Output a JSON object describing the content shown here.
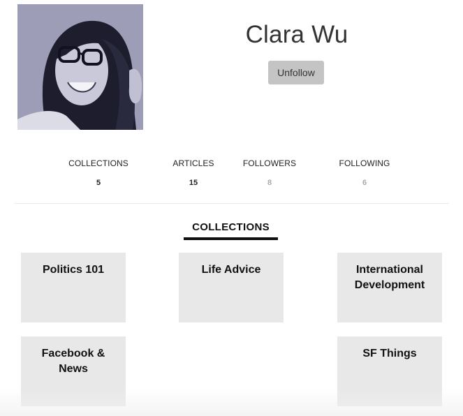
{
  "profile": {
    "name": "Clara Wu",
    "unfollow_label": "Unfollow",
    "avatar_icon": "profile-photo"
  },
  "stats": [
    {
      "label": "COLLECTIONS",
      "value": "5"
    },
    {
      "label": "ARTICLES",
      "value": "15"
    },
    {
      "label": "FOLLOWERS",
      "value": "8"
    },
    {
      "label": "FOLLOWING",
      "value": "6"
    }
  ],
  "collections_section": {
    "title": "COLLECTIONS",
    "items": [
      {
        "title": "Politics 101"
      },
      {
        "title": "Life Advice"
      },
      {
        "title": "International Development"
      },
      {
        "title": "Facebook & News"
      },
      {
        "title": "SF Things"
      }
    ]
  },
  "colors": {
    "button_bg": "#c4c4c4",
    "card_bg": "#e8e8e8",
    "underline": "#111111",
    "muted_value": "#aaaaaa"
  }
}
